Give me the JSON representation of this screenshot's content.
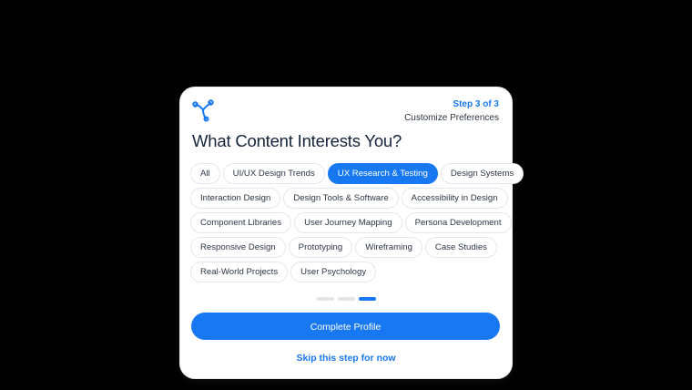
{
  "header": {
    "logo_icon": "tri-node-logo-icon",
    "step_count": "Step 3 of 3",
    "step_title": "Customize Preferences"
  },
  "title": "What Content Interests You?",
  "interests": {
    "rows": [
      [
        {
          "label": "All",
          "selected": false
        },
        {
          "label": "UI/UX Design Trends",
          "selected": false
        },
        {
          "label": "UX Research & Testing",
          "selected": true
        },
        {
          "label": "Design Systems",
          "selected": false
        }
      ],
      [
        {
          "label": "Interaction Design",
          "selected": false
        },
        {
          "label": "Design Tools & Software",
          "selected": false
        },
        {
          "label": "Accessibility in Design",
          "selected": false
        }
      ],
      [
        {
          "label": "Component Libraries",
          "selected": false
        },
        {
          "label": "User Journey Mapping",
          "selected": false
        },
        {
          "label": "Persona Development",
          "selected": false
        }
      ],
      [
        {
          "label": "Responsive Design",
          "selected": false
        },
        {
          "label": "Prototyping",
          "selected": false
        },
        {
          "label": "Wireframing",
          "selected": false
        },
        {
          "label": "Case Studies",
          "selected": false
        }
      ],
      [
        {
          "label": "Real-World Projects",
          "selected": false
        },
        {
          "label": "User Psychology",
          "selected": false
        }
      ]
    ]
  },
  "progress": {
    "total_steps": 3,
    "current_step": 3
  },
  "actions": {
    "primary_label": "Complete Profile",
    "skip_label": "Skip this step for now"
  },
  "colors": {
    "accent": "#1778f2",
    "text_dark": "#13233a",
    "chip_border": "#e3e7ed",
    "background": "#000000"
  }
}
